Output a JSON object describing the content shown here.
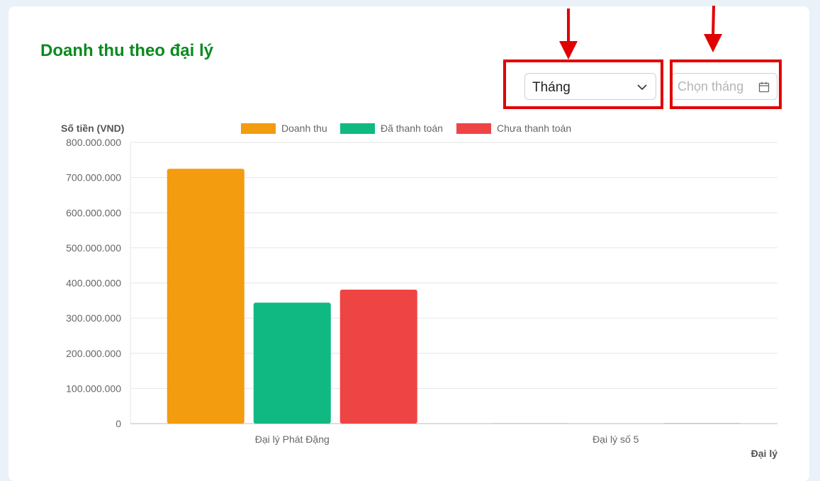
{
  "header": {
    "title": "Doanh thu theo đại lý"
  },
  "filters": {
    "period_select_value": "Tháng",
    "month_placeholder": "Chọn tháng"
  },
  "icons": {
    "select": "chevron-down-icon",
    "calendar": "calendar-icon",
    "annotation": "red-arrow-icon"
  },
  "colors": {
    "title": "#0b8a1f",
    "highlight": "#e00000"
  },
  "chart_data": {
    "type": "bar",
    "title": "",
    "ylabel": "Số tiền (VND)",
    "xlabel": "Đại lý",
    "categories": [
      "Đại lý Phát Đặng",
      "Đại lý số 5"
    ],
    "series": [
      {
        "name": "Doanh thu",
        "color": "#f39c0f",
        "values": [
          725000000,
          1500000
        ]
      },
      {
        "name": "Đã thanh toán",
        "color": "#10b981",
        "values": [
          344000000,
          0
        ]
      },
      {
        "name": "Chưa thanh toán",
        "color": "#ef4444",
        "values": [
          381000000,
          1500000
        ]
      }
    ],
    "ylim": [
      0,
      800000000
    ],
    "yticks": [
      0,
      100000000,
      200000000,
      300000000,
      400000000,
      500000000,
      600000000,
      700000000,
      800000000
    ],
    "ytick_labels": [
      "0",
      "100.000.000",
      "200.000.000",
      "300.000.000",
      "400.000.000",
      "500.000.000",
      "600.000.000",
      "700.000.000",
      "800.000.000"
    ],
    "grid": true,
    "legend_position": "top"
  }
}
